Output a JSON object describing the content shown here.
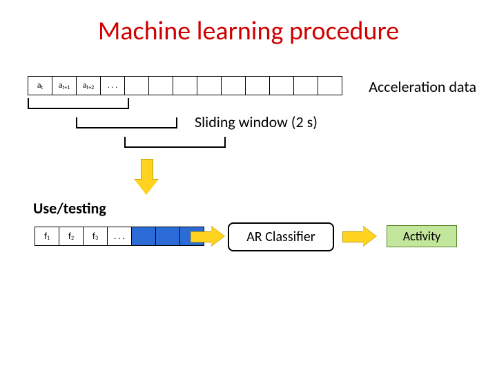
{
  "title": "Machine learning procedure",
  "accel": {
    "cells": [
      "a_t",
      "a_t+1",
      "a_t+2",
      ". . ."
    ],
    "label": "Acceleration data"
  },
  "sliding_window_label": "Sliding window (2 s)",
  "use_testing": "Use/testing",
  "features": {
    "cells": [
      "f_1",
      "f_2",
      "f_3",
      ". . ."
    ]
  },
  "classifier": "AR Classifier",
  "activity": "Activity"
}
